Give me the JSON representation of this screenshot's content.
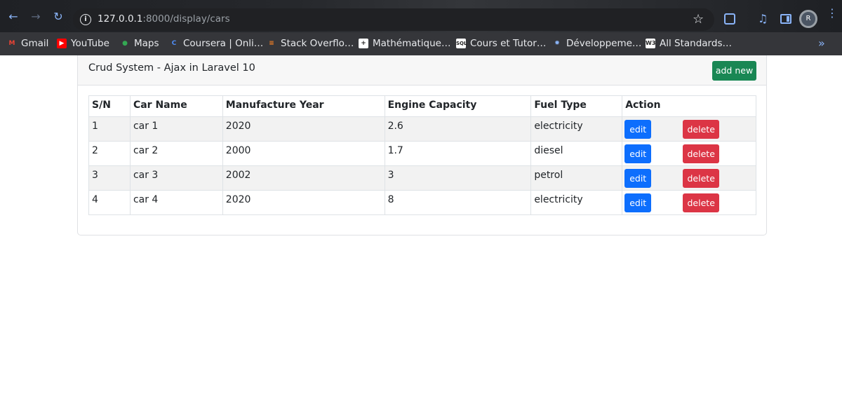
{
  "browser": {
    "url_host": "127.0.0.1",
    "url_rest": ":8000/display/cars",
    "avatar_initial": "R",
    "bookmarks": [
      {
        "label": "Gmail",
        "icon": "gmail-icon",
        "color": "#ea4335"
      },
      {
        "label": "YouTube",
        "icon": "youtube-icon",
        "color": "#ff0000"
      },
      {
        "label": "Maps",
        "icon": "maps-icon",
        "color": "#34a853"
      },
      {
        "label": "Coursera | Onli…",
        "icon": "coursera-icon",
        "color": "#0056d2"
      },
      {
        "label": "Stack Overflo…",
        "icon": "stackoverflow-icon",
        "color": "#f48024"
      },
      {
        "label": "Mathématique…",
        "icon": "math-icon",
        "color": "#ffffff"
      },
      {
        "label": "Cours et Tutor…",
        "icon": "sql-icon",
        "color": "#ffffff"
      },
      {
        "label": "Développeme…",
        "icon": "dev-icon",
        "color": "#8ab4f8"
      },
      {
        "label": "All Standards…",
        "icon": "w3-icon",
        "color": "#ffffff"
      }
    ]
  },
  "card": {
    "title": "Crud System - Ajax in Laravel 10",
    "add_label": "add new"
  },
  "table": {
    "headers": [
      "S/N",
      "Car Name",
      "Manufacture Year",
      "Engine Capacity",
      "Fuel Type",
      "Action"
    ],
    "rows": [
      {
        "sn": "1",
        "name": "car 1",
        "year": "2020",
        "engine": "2.6",
        "fuel": "electricity"
      },
      {
        "sn": "2",
        "name": "car 2",
        "year": "2000",
        "engine": "1.7",
        "fuel": "diesel"
      },
      {
        "sn": "3",
        "name": "car 3",
        "year": "2002",
        "engine": "3",
        "fuel": "petrol"
      },
      {
        "sn": "4",
        "name": "car 4",
        "year": "2020",
        "engine": "8",
        "fuel": "electricity"
      }
    ],
    "edit_label": "edit",
    "delete_label": "delete"
  },
  "colors": {
    "add": "#198754",
    "edit": "#0d6efd",
    "delete": "#dc3545"
  }
}
